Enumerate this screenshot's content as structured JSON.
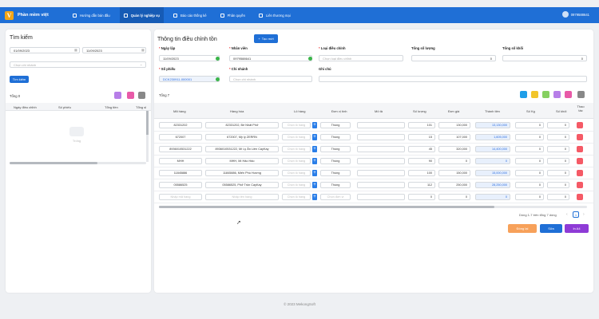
{
  "app": {
    "name": "Phần mềm việt",
    "user": "0979588641",
    "footer": "© 2023 MekongSoft"
  },
  "nav": [
    "Hướng dẫn bán đầu",
    "Quản lý nghiệp vụ",
    "Báo cáo thống kê",
    "Phân quyền",
    "Liên thương mại"
  ],
  "search": {
    "title": "Tìm kiếm",
    "date_from": "01/09/2023",
    "date_to": "11/09/2023",
    "branch_placeholder": "Chọn chi nhánh",
    "search_button": "Tìm kiếm",
    "total_label": "Tổng 0",
    "columns": [
      "Ngày điều chỉnh",
      "Số phiếu",
      "Tổng tiền",
      "Tổng sl"
    ],
    "empty_text": "Trống"
  },
  "form": {
    "title": "Thông tin điều chỉnh tồn",
    "new_button": "Tạo mới",
    "date_label": "Ngày lập",
    "date_value": "11/09/2023",
    "staff_label": "Nhân viên",
    "staff_value": "0979588641",
    "type_label": "Loại điều chỉnh",
    "type_placeholder": "Chọn loại điều chỉnh",
    "total_qty_label": "Tổng số lượng",
    "total_qty_value": "0",
    "total_block_label": "Tổng số khối",
    "total_block_value": "0",
    "slip_label": "Số phiếu",
    "slip_value": "DCK230911-000001",
    "branch_label": "Chi nhánh",
    "branch_placeholder": "Chọn chi nhánh",
    "note_label": "Ghi chú",
    "note_value": "",
    "items_total": "Tổng 7"
  },
  "table": {
    "columns": [
      "Mã hàng",
      "Hàng hóa",
      "Lô hàng",
      "Đơn vị tính",
      "Mô tả",
      "Số lượng",
      "Đơn giá",
      "Thành tiền",
      "Số Kg",
      "Số khối",
      "Thao tác"
    ],
    "lot_placeholder": "Chọn lô hàng",
    "unit": "Thùng",
    "rows": [
      {
        "code": "82331202",
        "name": "82331202, Bé Nhất Phở",
        "qty": "101",
        "price": "130,000",
        "amount": "13,130,000",
        "kg": "0",
        "block": "0"
      },
      {
        "code": "672007",
        "name": "672007, Mỳ ly ZERRN",
        "qty": "15",
        "price": "107,000",
        "amount": "1,605,000",
        "kg": "0",
        "block": "0"
      },
      {
        "code": "8936010531222",
        "name": "8936010531222, Mì Ly Ăn Liền CayKay",
        "qty": "45",
        "price": "320,000",
        "amount": "14,400,000",
        "kg": "0",
        "block": "0"
      },
      {
        "code": "MHH",
        "name": "MHH, Mì Hảo Hảo",
        "qty": "90",
        "price": "0",
        "amount": "0",
        "kg": "0",
        "block": "0"
      },
      {
        "code": "11845886",
        "name": "11845886, Miến Phú Hương",
        "qty": "100",
        "price": "150,000",
        "amount": "15,000,000",
        "kg": "0",
        "block": "0"
      },
      {
        "code": "05586525",
        "name": "05586525, Phở Trộn CayKay",
        "qty": "112",
        "price": "250,000",
        "amount": "28,250,000",
        "kg": "0",
        "block": "0"
      },
      {
        "code": "Nhập mã hàng",
        "name": "Nhập tên hàng",
        "qty": "0",
        "price": "0",
        "amount": "0",
        "kg": "0",
        "block": "0",
        "placeholder": true
      }
    ],
    "empty_unit": "Chọn đơn vị",
    "pagination_text": "Dòng 1-7 trên tổng 7 dòng",
    "page": "1"
  },
  "actions": {
    "save": "Đóng lại",
    "edit": "Sửa",
    "print": "In A4"
  },
  "colors": {
    "primary": "#1f6fd6",
    "danger": "#f55a66",
    "purple": "#8e3bd6",
    "orange": "#f7a15a"
  }
}
